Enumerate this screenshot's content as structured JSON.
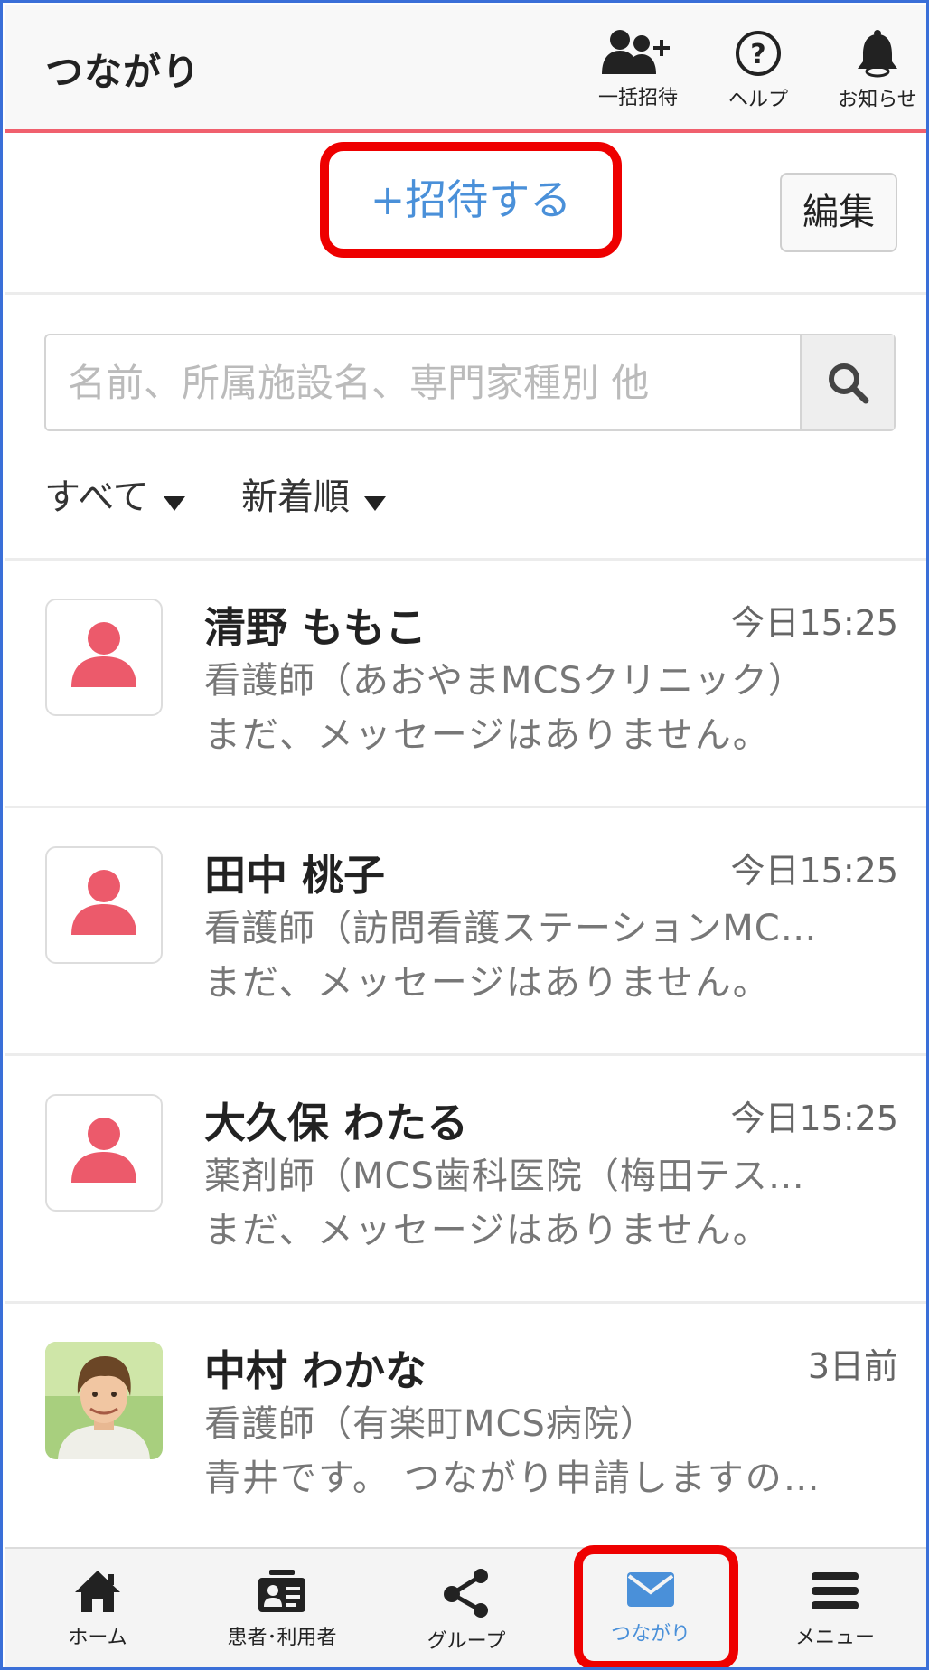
{
  "header": {
    "title": "つながり",
    "buttons": [
      {
        "label": "一括招待",
        "icon": "bulk-invite-icon"
      },
      {
        "label": "ヘルプ",
        "icon": "help-icon"
      },
      {
        "label": "お知らせ",
        "icon": "bell-icon"
      }
    ]
  },
  "toolbar": {
    "invite_label": "+招待する",
    "edit_label": "編集"
  },
  "search": {
    "placeholder": "名前、所属施設名、専門家種別 他",
    "value": ""
  },
  "filters": {
    "category": "すべて",
    "sort": "新着順"
  },
  "contacts": [
    {
      "name": "清野 ももこ",
      "time": "今日15:25",
      "subtitle": "看護師（あおやまMCSクリニック）",
      "message": "まだ、メッセージはありません。",
      "avatar": "default-person"
    },
    {
      "name": "田中 桃子",
      "time": "今日15:25",
      "subtitle": "看護師（訪問看護ステーションMC…",
      "message": "まだ、メッセージはありません。",
      "avatar": "default-person"
    },
    {
      "name": "大久保 わたる",
      "time": "今日15:25",
      "subtitle": "薬剤師（MCS歯科医院（梅田テス…",
      "message": "まだ、メッセージはありません。",
      "avatar": "default-person"
    },
    {
      "name": "中村 わかな",
      "time": "3日前",
      "subtitle": "看護師（有楽町MCS病院）",
      "message": "青井です。 つながり申請しますの…",
      "avatar": "photo"
    }
  ],
  "bottom_nav": [
    {
      "label": "ホーム",
      "icon": "home-icon"
    },
    {
      "label": "患者･利用者",
      "icon": "patient-card-icon"
    },
    {
      "label": "グループ",
      "icon": "group-share-icon"
    },
    {
      "label": "つながり",
      "icon": "mail-icon",
      "active": true
    },
    {
      "label": "メニュー",
      "icon": "menu-icon"
    }
  ],
  "colors": {
    "accent": "#f0606e",
    "link": "#4a90d9",
    "highlight": "#ee0000",
    "frame": "#3a6fd8"
  }
}
